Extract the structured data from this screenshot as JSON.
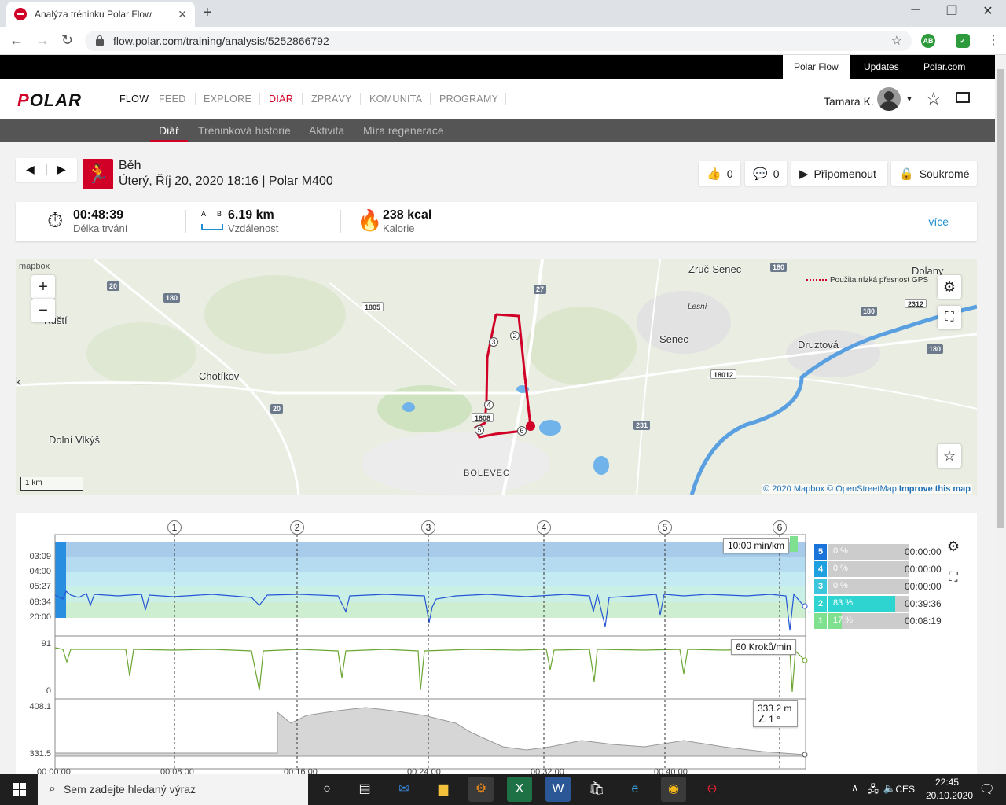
{
  "browser": {
    "tab_title": "Analýza tréninku Polar Flow",
    "url": "flow.polar.com/training/analysis/5252866792",
    "new_tab": "+",
    "close_tab": "✕",
    "ext1": "AB"
  },
  "topbar": {
    "items": [
      "Polar Flow",
      "Updates",
      "Polar.com"
    ]
  },
  "nav": {
    "logo_left": "P",
    "logo_rest": "OLAR",
    "items": [
      "FLOW",
      "FEED",
      "EXPLORE",
      "DIÁŘ",
      "ZPRÁVY",
      "KOMUNITA",
      "PROGRAMY"
    ],
    "user": "Tamara K."
  },
  "subnav": {
    "items": [
      "Diář",
      "Tréninková historie",
      "Aktivita",
      "Míra regenerace"
    ]
  },
  "session": {
    "sport": "Běh",
    "date_line": "Úterý, Říj 20, 2020 18:16 | Polar M400",
    "likes": "0",
    "comments": "0",
    "remind": "Připomenout",
    "privacy": "Soukromé"
  },
  "summary": {
    "duration_value": "00:48:39",
    "duration_label": "Délka trvání",
    "distance_value": "6.19 km",
    "distance_label": "Vzdálenost",
    "distance_icon_a": "A",
    "distance_icon_b": "B",
    "calories_value": "238 kcal",
    "calories_label": "Kalorie",
    "more": "více"
  },
  "map": {
    "labels": [
      "Zruč-Senec",
      "Dolany",
      "Senec",
      "Druztová",
      "Chotíkov",
      "Dolní Vlkýš",
      "Kůští",
      "BOLEVEC",
      "Lesní",
      "k"
    ],
    "shields": [
      "20",
      "180",
      "1805",
      "27",
      "180",
      "180",
      "2312",
      "180",
      "18012",
      "1808",
      "231",
      "20"
    ],
    "laps": [
      "2",
      "3",
      "4",
      "5",
      "6"
    ],
    "gps_legend": "Použita nízká přesnost GPS",
    "copyright_1": "© 2020 Mapbox",
    "copyright_2": "© OpenStreetMap",
    "copyright_3": "Improve this map",
    "scale": "1 km",
    "mapbox": "mapbox",
    "zoom_in": "+",
    "zoom_out": "−"
  },
  "chart": {
    "lap_markers": [
      "1",
      "2",
      "3",
      "4",
      "5",
      "6"
    ],
    "pace_ticks": [
      "03:09",
      "04:00",
      "05:27",
      "08:34",
      "20:00"
    ],
    "cadence_ticks": [
      "91",
      "0"
    ],
    "altitude_ticks": [
      "408.1",
      "331.5"
    ],
    "x_ticks": [
      "00:00:00",
      "00:08:00",
      "00:16:00",
      "00:24:00",
      "00:32:00",
      "00:40:00"
    ],
    "pace_tooltip": "10:00  min/km",
    "cadence_tooltip": "60  Kroků/min",
    "altitude_tooltip_1": "333.2  m",
    "altitude_tooltip_2": "1 °",
    "zones": [
      {
        "num": "5",
        "pct": "0 %",
        "fill": 0,
        "time": "00:00:00",
        "color": "#1a73d9"
      },
      {
        "num": "4",
        "pct": "0 %",
        "fill": 0,
        "time": "00:00:00",
        "color": "#1ea0e0"
      },
      {
        "num": "3",
        "pct": "0 %",
        "fill": 0,
        "time": "00:00:00",
        "color": "#3bc6dc"
      },
      {
        "num": "2",
        "pct": "83 %",
        "fill": 0.83,
        "time": "00:39:36",
        "color": "#2ed4d0"
      },
      {
        "num": "1",
        "pct": "17 %",
        "fill": 0.17,
        "time": "00:08:19",
        "color": "#7fe08f"
      }
    ]
  },
  "taskbar": {
    "search": "Sem zadejte hledaný výraz",
    "lang": "CES",
    "time": "22:45",
    "date": "20.10.2020"
  }
}
